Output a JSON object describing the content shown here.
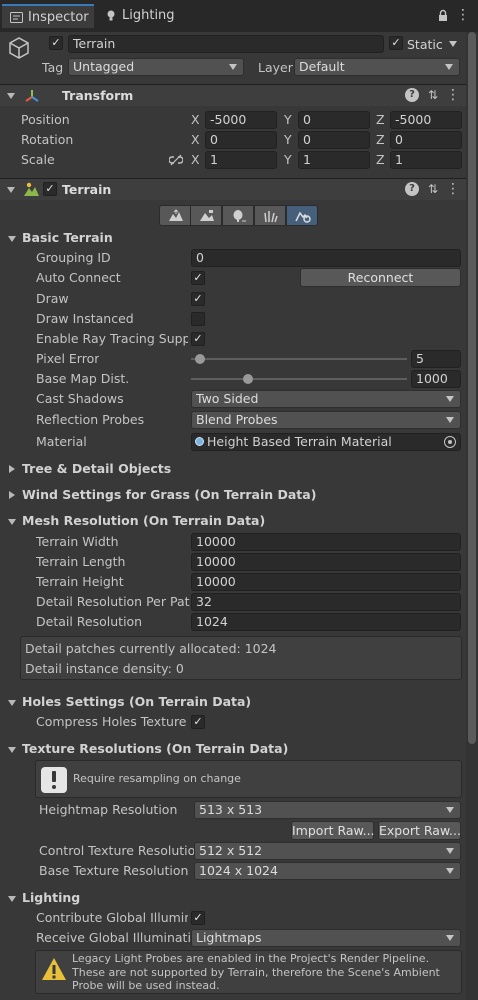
{
  "tabs": [
    {
      "label": "Inspector",
      "icon": "info-icon",
      "active": true
    },
    {
      "label": "Lighting",
      "icon": "lightbulb-icon",
      "active": false
    }
  ],
  "object": {
    "name": "Terrain",
    "active": true,
    "static_label": "Static",
    "static_checked": true,
    "tag_label": "Tag",
    "tag_value": "Untagged",
    "layer_label": "Layer",
    "layer_value": "Default"
  },
  "transform": {
    "title": "Transform",
    "position_label": "Position",
    "rotation_label": "Rotation",
    "scale_label": "Scale",
    "position": {
      "x": "-5000",
      "y": "0",
      "z": "-5000"
    },
    "rotation": {
      "x": "0",
      "y": "0",
      "z": "0"
    },
    "scale": {
      "x": "1",
      "y": "1",
      "z": "1"
    },
    "axis_x": "X",
    "axis_y": "Y",
    "axis_z": "Z"
  },
  "terrain": {
    "title": "Terrain",
    "enabled": true,
    "tools": [
      "raise-terrain-icon",
      "paint-terrain-icon",
      "paint-trees-icon",
      "paint-details-icon",
      "terrain-settings-icon"
    ],
    "selected_tool": 4
  },
  "basic_terrain": {
    "title": "Basic Terrain",
    "grouping_id_label": "Grouping ID",
    "grouping_id": "0",
    "auto_connect_label": "Auto Connect",
    "auto_connect": true,
    "reconnect_label": "Reconnect",
    "draw_label": "Draw",
    "draw": true,
    "draw_instanced_label": "Draw Instanced",
    "draw_instanced": false,
    "ray_tracing_label": "Enable Ray Tracing Suppor",
    "ray_tracing": true,
    "pixel_error_label": "Pixel Error",
    "pixel_error": "5",
    "pixel_error_fraction": 0.02,
    "base_map_label": "Base Map Dist.",
    "base_map": "1000",
    "base_map_fraction": 0.25,
    "cast_shadows_label": "Cast Shadows",
    "cast_shadows": "Two Sided",
    "reflection_label": "Reflection Probes",
    "reflection": "Blend Probes",
    "material_label": "Material",
    "material": "Height Based Terrain Material"
  },
  "collapsed_sections": [
    "Tree & Detail Objects",
    "Wind Settings for Grass (On Terrain Data)"
  ],
  "mesh_resolution": {
    "title": "Mesh Resolution (On Terrain Data)",
    "width_label": "Terrain Width",
    "width": "10000",
    "length_label": "Terrain Length",
    "length": "10000",
    "height_label": "Terrain Height",
    "height": "10000",
    "detail_per_patch_label": "Detail Resolution Per Patch",
    "detail_per_patch": "32",
    "detail_res_label": "Detail Resolution",
    "detail_res": "1024",
    "info_line1": "Detail patches currently allocated: 1024",
    "info_line2": "Detail instance density: 0"
  },
  "holes": {
    "title": "Holes Settings (On Terrain Data)",
    "compress_label": "Compress Holes Texture",
    "compress": true
  },
  "texture_res": {
    "title": "Texture Resolutions (On Terrain Data)",
    "note": "Require resampling on change",
    "heightmap_label": "Heightmap Resolution",
    "heightmap": "513 x 513",
    "import_label": "Import Raw...",
    "export_label": "Export Raw...",
    "control_label": "Control Texture Resolution",
    "control": "512 x 512",
    "base_label": "Base Texture Resolution",
    "base": "1024 x 1024"
  },
  "lighting": {
    "title": "Lighting",
    "contribute_label": "Contribute Global Illuminati",
    "contribute": true,
    "receive_label": "Receive Global Illumination",
    "receive": "Lightmaps",
    "warning": "Legacy Light Probes are enabled in the Project's Render Pipeline. These are not supported by Terrain, therefore the Scene's Ambient Probe will be used instead."
  },
  "colors": {
    "background": "#383838",
    "field": "#2a2a2a",
    "accent": "#3a79bb",
    "warning": "#e8c13a"
  }
}
